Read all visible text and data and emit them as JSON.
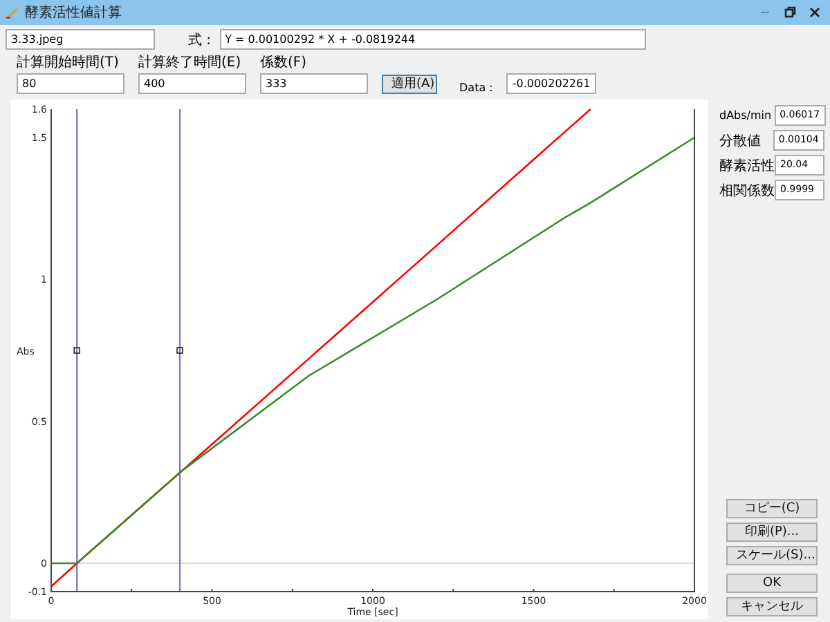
{
  "window": {
    "title": "酵素活性値計算"
  },
  "file_field": {
    "value": "3.33.jpeg"
  },
  "formula": {
    "label": "式 :",
    "value": "Y = 0.00100292 * X + -0.0819244"
  },
  "params": [
    {
      "label": "計算開始時間(T)",
      "value": "80"
    },
    {
      "label": "計算終了時間(E)",
      "value": "400"
    },
    {
      "label": "係数(F)",
      "value": "333"
    }
  ],
  "apply_button": "適用(A)",
  "data": {
    "label": "Data :",
    "value": "-0.000202261"
  },
  "chart_data": {
    "type": "line",
    "xlabel": "Time [sec]",
    "ylabel": "Abs",
    "x": [
      0,
      80,
      400,
      800,
      1200,
      1600,
      1677,
      2000
    ],
    "series": [
      {
        "color": "#ff0000",
        "values": [
          -0.082,
          0,
          0.319,
          0.72,
          1.121,
          1.523,
          1.6,
          null
        ]
      },
      {
        "color": "#3a8a2a",
        "values": [
          0,
          0,
          0.32,
          0.66,
          0.93,
          1.22,
          1.27,
          1.5
        ]
      }
    ],
    "xlim": [
      0,
      2000
    ],
    "ylim": [
      -0.1,
      1.6
    ],
    "xticks": [
      0,
      500,
      1000,
      1500,
      2000
    ],
    "yticks": [
      -0.1,
      0,
      0.5,
      1,
      1.5,
      1.6
    ],
    "ref_lines": [
      {
        "axis": "x",
        "value": 80
      },
      {
        "axis": "x",
        "value": 400
      }
    ]
  },
  "results": [
    {
      "label": "dAbs/min",
      "value": "0.06017"
    },
    {
      "label": "分散値",
      "value": "0.00104"
    },
    {
      "label": "酵素活性",
      "value": "20.04"
    },
    {
      "label": "相関係数",
      "value": "0.9999"
    }
  ],
  "buttons": [
    "コピー(C)",
    "印刷(P)...",
    "スケール(S)...",
    "OK",
    "キャンセル"
  ]
}
